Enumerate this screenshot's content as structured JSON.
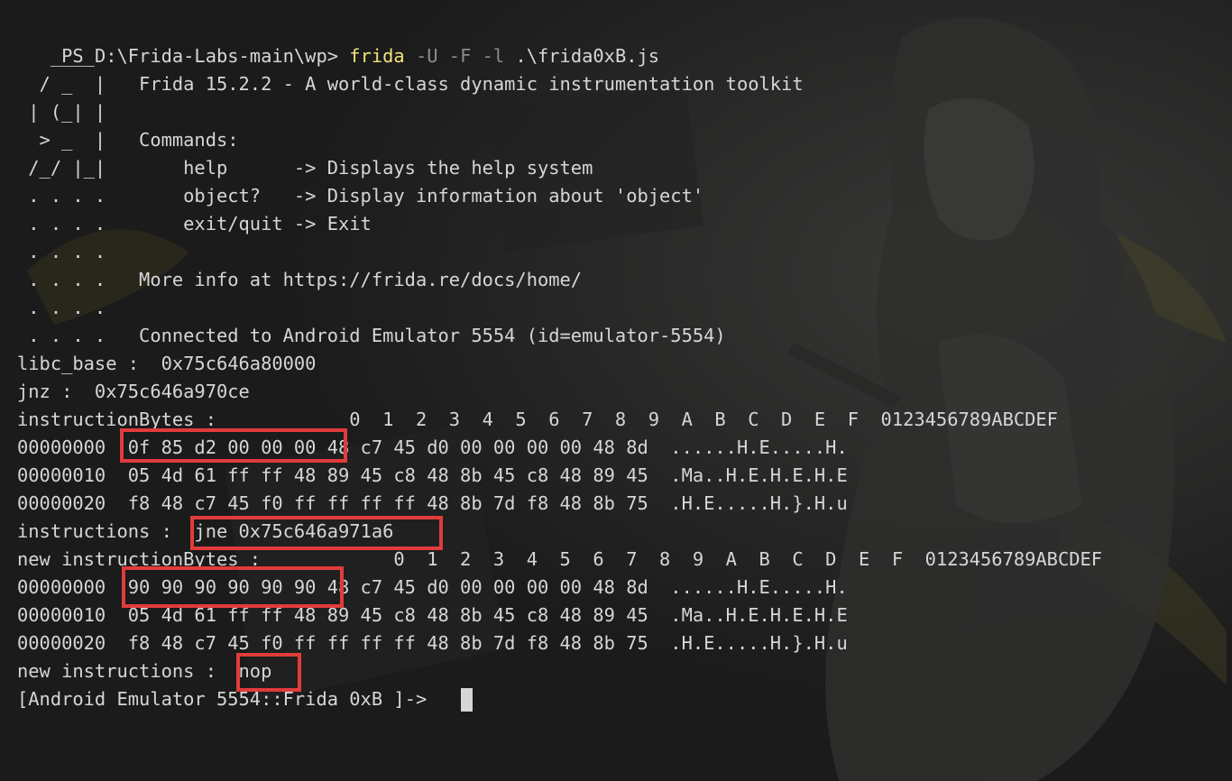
{
  "terminal": {
    "prompt": "PS D:\\Frida-Labs-main\\wp> ",
    "command_name": "frida",
    "command_flags": " -U -F -l ",
    "command_script": ".\\frida0xB.js",
    "lines": [
      "   ____",
      "  / _  |   Frida 15.2.2 - A world-class dynamic instrumentation toolkit",
      " | (_| |",
      "  > _  |   Commands:",
      " /_/ |_|       help      -> Displays the help system",
      " . . . .       object?   -> Display information about 'object'",
      " . . . .       exit/quit -> Exit",
      " . . . .",
      " . . . .   More info at https://frida.re/docs/home/",
      " . . . .",
      " . . . .   Connected to Android Emulator 5554 (id=emulator-5554)",
      "libc_base :  0x75c646a80000",
      "jnz :  0x75c646a970ce",
      "instructionBytes :            0  1  2  3  4  5  6  7  8  9  A  B  C  D  E  F  0123456789ABCDEF",
      "00000000  0f 85 d2 00 00 00 48 c7 45 d0 00 00 00 00 48 8d  ......H.E.....H.",
      "00000010  05 4d 61 ff ff 48 89 45 c8 48 8b 45 c8 48 89 45  .Ma..H.E.H.E.H.E",
      "00000020  f8 48 c7 45 f0 ff ff ff ff 48 8b 7d f8 48 8b 75  .H.E.....H.}.H.u",
      "instructions :  jne 0x75c646a971a6",
      "new instructionBytes :            0  1  2  3  4  5  6  7  8  9  A  B  C  D  E  F  0123456789ABCDEF",
      "00000000  90 90 90 90 90 90 48 c7 45 d0 00 00 00 00 48 8d  ......H.E.....H.",
      "00000010  05 4d 61 ff ff 48 89 45 c8 48 8b 45 c8 48 89 45  .Ma..H.E.H.E.H.E",
      "00000020  f8 48 c7 45 f0 ff ff ff ff 48 8b 7d f8 48 8b 75  .H.E.....H.}.H.u",
      "new instructions :  nop",
      "[Android Emulator 5554::Frida 0xB ]-> "
    ]
  },
  "colors": {
    "background": "#1a1a1a",
    "text": "#d6d6d6",
    "command": "#f2e27a",
    "flags": "#8c8c8c",
    "highlight": "#e23b3b"
  }
}
